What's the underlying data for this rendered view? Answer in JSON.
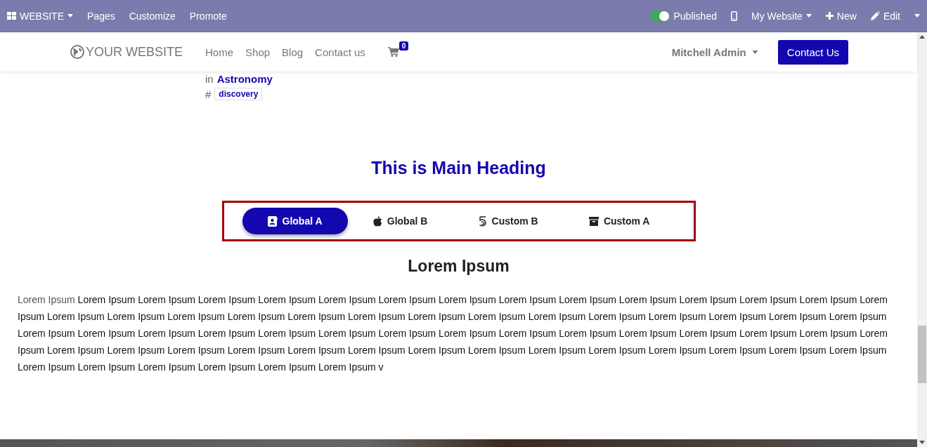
{
  "admin_bar": {
    "left": [
      {
        "label": "WEBSITE",
        "kind": "apps"
      },
      {
        "label": "Pages",
        "kind": "plain"
      },
      {
        "label": "Customize",
        "kind": "plain"
      },
      {
        "label": "Promote",
        "kind": "plain"
      }
    ],
    "published": {
      "label": "Published",
      "on": true
    },
    "right": [
      {
        "label": "My Website",
        "kind": "dropdown"
      },
      {
        "label": "New",
        "kind": "new"
      },
      {
        "label": "Edit",
        "kind": "edit"
      }
    ]
  },
  "navbar": {
    "logo": "YOUR WEBSITE",
    "links": [
      "Home",
      "Shop",
      "Blog",
      "Contact us"
    ],
    "cart_count": "0",
    "user": "Mitchell Admin",
    "cta": "Contact Us"
  },
  "post_meta": {
    "prefix": "in",
    "category": "Astronomy",
    "hash": "#",
    "tag": "discovery"
  },
  "heading": "This is Main Heading",
  "tabs": [
    {
      "label": "Global A",
      "kind": "contact",
      "selected": true
    },
    {
      "label": "Global B",
      "kind": "apple",
      "selected": false
    },
    {
      "label": "Custom B",
      "kind": "five",
      "selected": false
    },
    {
      "label": "Custom A",
      "kind": "archive",
      "selected": false
    }
  ],
  "panel": {
    "title": "Lorem Ipsum",
    "lead": "Lorem Ipsum",
    "body": "Lorem Ipsum Lorem Ipsum Lorem Ipsum Lorem Ipsum Lorem Ipsum Lorem Ipsum Lorem Ipsum Lorem Ipsum Lorem Ipsum Lorem Ipsum Lorem Ipsum Lorem Ipsum Lorem Ipsum Lorem Ipsum Lorem Ipsum Lorem Ipsum Lorem Ipsum Lorem Ipsum Lorem Ipsum Lorem Ipsum Lorem Ipsum Lorem Ipsum Lorem Ipsum Lorem Ipsum Lorem Ipsum Lorem Ipsum Lorem Ipsum Lorem Ipsum Lorem Ipsum Lorem Ipsum Lorem Ipsum Lorem Ipsum Lorem Ipsum Lorem Ipsum Lorem Ipsum Lorem Ipsum Lorem Ipsum Lorem Ipsum Lorem Ipsum Lorem Ipsum Lorem Ipsum Lorem Ipsum Lorem Ipsum Lorem Ipsum Lorem Ipsum Lorem Ipsum Lorem Ipsum Lorem Ipsum Lorem Ipsum Lorem Ipsum Lorem Ipsum Lorem Ipsum Lorem Ipsum Lorem Ipsum Lorem Ipsum Lorem Ipsum Lorem Ipsum Lorem Ipsum Lorem Ipsum Lorem Ipsum Lorem Ipsum Lorem Ipsum Lorem Ipsum v"
  }
}
